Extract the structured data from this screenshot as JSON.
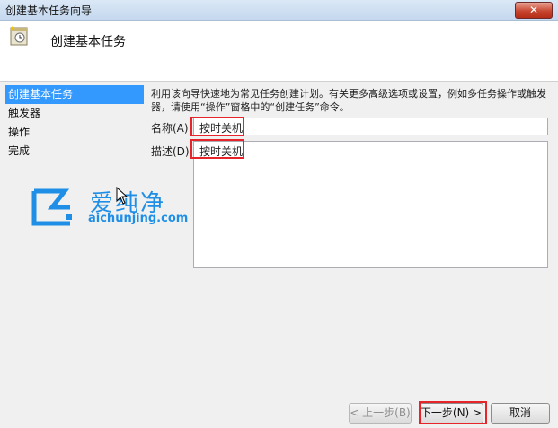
{
  "window": {
    "title": "创建基本任务向导",
    "close_label": "✕"
  },
  "header": {
    "title": "创建基本任务"
  },
  "sidebar": {
    "items": [
      {
        "label": "创建基本任务"
      },
      {
        "label": "触发器"
      },
      {
        "label": "操作"
      },
      {
        "label": "完成"
      }
    ]
  },
  "main": {
    "description": "利用该向导快速地为常见任务创建计划。有关更多高级选项或设置，例如多任务操作或触发器，请使用“操作”窗格中的“创建任务”命令。",
    "name_label": "名称(A):",
    "name_value": "按时关机",
    "desc_label": "描述(D):",
    "desc_value": "按时关机"
  },
  "watermark": {
    "brand": "爱纯净",
    "url": "aichunjing.com"
  },
  "buttons": {
    "back": "< 上一步(B)",
    "next": "下一步(N) >",
    "cancel": "取消"
  },
  "colors": {
    "accent": "#3399ff",
    "highlight": "#e8242b",
    "watermark": "#1e8ee6"
  }
}
